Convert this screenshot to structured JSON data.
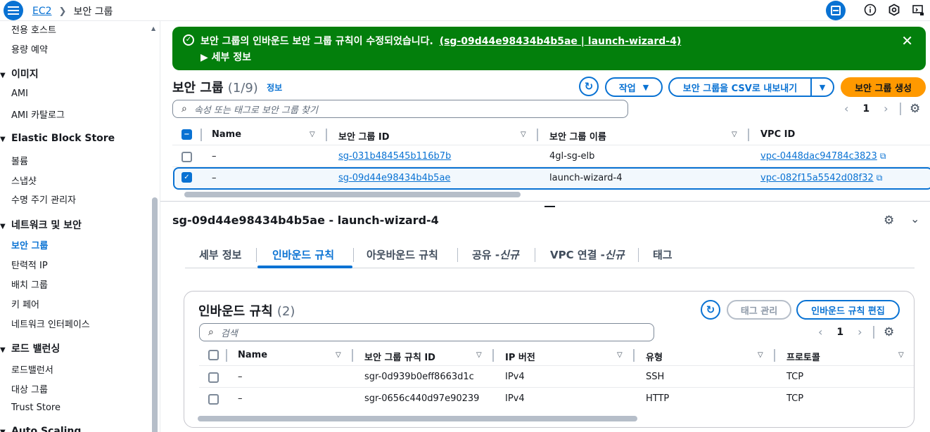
{
  "topbar": {
    "crumbs": [
      "EC2",
      "보안 그룹"
    ],
    "icons": [
      "menu-icon",
      "cloudshell-icon",
      "info-icon",
      "settings-icon",
      "feedback-icon"
    ]
  },
  "sidebar": {
    "items_a": [
      "전용 호스트",
      "용량 예약"
    ],
    "section_images": "이미지",
    "items_images": [
      "AMI",
      "AMI 카탈로그"
    ],
    "section_ebs": "Elastic Block Store",
    "items_ebs": [
      "볼륨",
      "스냅샷",
      "수명 주기 관리자"
    ],
    "section_net": "네트워크 및 보안",
    "items_net": [
      "보안 그룹",
      "탄력적 IP",
      "배치 그룹",
      "키 페어",
      "네트워크 인터페이스"
    ],
    "section_lb": "로드 밸런싱",
    "items_lb": [
      "로드밸런서",
      "대상 그룹",
      "Trust Store"
    ],
    "section_as": "Auto Scaling"
  },
  "flash": {
    "message": "보안 그룹의 인바운드 보안 그룹 규칙이 수정되었습니다.",
    "link": "(sg-09d44e98434b4b5ae | launch-wizard-4)",
    "details": "세부 정보",
    "color": "#037f0c"
  },
  "sg": {
    "title": "보안 그룹",
    "count": "(1/9)",
    "info": "정보",
    "actions": "작업",
    "export": "보안 그룹을 CSV로 내보내기",
    "create": "보안 그룹 생성",
    "search_placeholder": "속성 또는 태그로 보안 그룹 찾기",
    "page": "1",
    "columns": [
      "Name",
      "보안 그룹 ID",
      "보안 그룹 이름",
      "VPC ID"
    ],
    "rows": [
      {
        "name": "–",
        "id": "sg-031b484545b116b7b",
        "group_name": "4gl-sg-elb",
        "vpc": "vpc-0448dac94784c3823",
        "selected": false
      },
      {
        "name": "–",
        "id": "sg-09d44e98434b4b5ae",
        "group_name": "launch-wizard-4",
        "vpc": "vpc-082f15a5542d08f32",
        "selected": true
      }
    ]
  },
  "detail": {
    "title": "sg-09d44e98434b4b5ae - launch-wizard-4",
    "tabs": [
      "세부 정보",
      "인바운드 규칙",
      "아웃바운드 규칙",
      "공유 -",
      "신규",
      "VPC 연결 -",
      "신규",
      "태그"
    ]
  },
  "inbound": {
    "title": "인바운드 규칙",
    "count": "(2)",
    "manage_tags": "태그 관리",
    "edit": "인바운드 규칙 편집",
    "search_placeholder": "검색",
    "page": "1",
    "columns": [
      "Name",
      "보안 그룹 규칙 ID",
      "IP 버전",
      "유형",
      "프로토콜"
    ],
    "rows": [
      {
        "name": "–",
        "rule_id": "sgr-0d939b0eff8663d1c",
        "ip": "IPv4",
        "type": "SSH",
        "protocol": "TCP"
      },
      {
        "name": "–",
        "rule_id": "sgr-0656c440d97e90239",
        "ip": "IPv4",
        "type": "HTTP",
        "protocol": "TCP"
      }
    ]
  }
}
